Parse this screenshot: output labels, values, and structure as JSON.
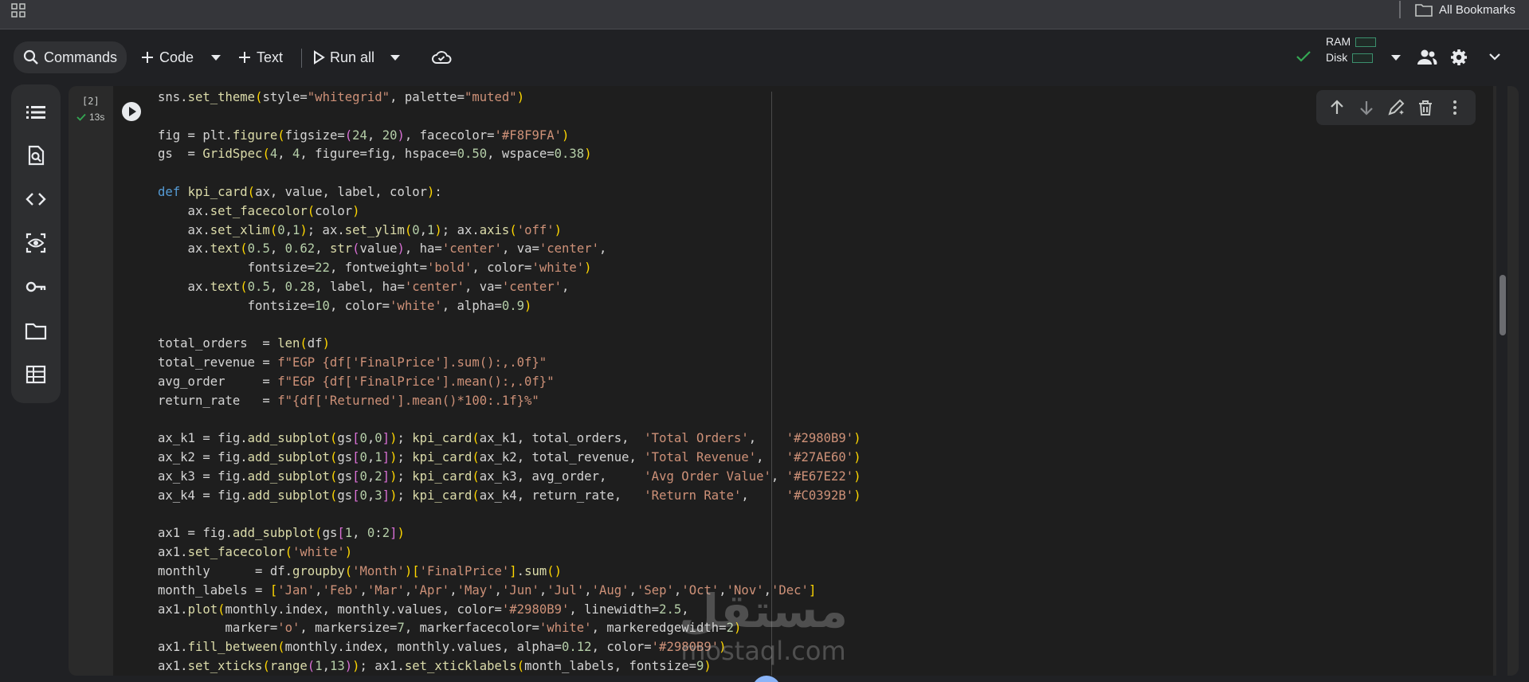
{
  "bookmarks_bar": {
    "all_bookmarks_label": "All Bookmarks",
    "apps_icon": "apps-grid-icon",
    "folder_icon": "folder-icon"
  },
  "toolbar": {
    "commands_label": "Commands",
    "code_label": "Code",
    "text_label": "Text",
    "run_all_label": "Run all",
    "ram_label": "RAM",
    "disk_label": "Disk"
  },
  "sidebar": {
    "items": [
      {
        "icon": "table-of-contents-icon"
      },
      {
        "icon": "find-replace-icon"
      },
      {
        "icon": "code-snippets-icon"
      },
      {
        "icon": "variables-icon"
      },
      {
        "icon": "secrets-key-icon"
      },
      {
        "icon": "files-folder-icon"
      },
      {
        "icon": "data-table-icon"
      }
    ]
  },
  "cell": {
    "execution_count": "[2]",
    "execution_time": "13s"
  },
  "code_lines": [
    "sns.set_theme(style=\"whitegrid\", palette=\"muted\")",
    "",
    "fig = plt.figure(figsize=(24, 20), facecolor='#F8F9FA')",
    "gs  = GridSpec(4, 4, figure=fig, hspace=0.50, wspace=0.38)",
    "",
    "def kpi_card(ax, value, label, color):",
    "    ax.set_facecolor(color)",
    "    ax.set_xlim(0,1); ax.set_ylim(0,1); ax.axis('off')",
    "    ax.text(0.5, 0.62, str(value), ha='center', va='center',",
    "            fontsize=22, fontweight='bold', color='white')",
    "    ax.text(0.5, 0.28, label, ha='center', va='center',",
    "            fontsize=10, color='white', alpha=0.9)",
    "",
    "total_orders  = len(df)",
    "total_revenue = f\"EGP {df['FinalPrice'].sum():,.0f}\"",
    "avg_order     = f\"EGP {df['FinalPrice'].mean():,.0f}\"",
    "return_rate   = f\"{df['Returned'].mean()*100:.1f}%\"",
    "",
    "ax_k1 = fig.add_subplot(gs[0,0]); kpi_card(ax_k1, total_orders,  'Total Orders',    '#2980B9')",
    "ax_k2 = fig.add_subplot(gs[0,1]); kpi_card(ax_k2, total_revenue, 'Total Revenue',   '#27AE60')",
    "ax_k3 = fig.add_subplot(gs[0,2]); kpi_card(ax_k3, avg_order,     'Avg Order Value', '#E67E22')",
    "ax_k4 = fig.add_subplot(gs[0,3]); kpi_card(ax_k4, return_rate,   'Return Rate',     '#C0392B')",
    "",
    "ax1 = fig.add_subplot(gs[1, 0:2])",
    "ax1.set_facecolor('white')",
    "monthly      = df.groupby('Month')['FinalPrice'].sum()",
    "month_labels = ['Jan','Feb','Mar','Apr','May','Jun','Jul','Aug','Sep','Oct','Nov','Dec']",
    "ax1.plot(monthly.index, monthly.values, color='#2980B9', linewidth=2.5,",
    "         marker='o', markersize=7, markerfacecolor='white', markeredgewidth=2)",
    "ax1.fill_between(monthly.index, monthly.values, alpha=0.12, color='#2980B9')",
    "ax1.set_xticks(range(1,13)); ax1.set_xticklabels(month_labels, fontsize=9)"
  ],
  "watermark": {
    "arabic": "مستقل",
    "domain": "mostaql.com"
  },
  "colors": {
    "accent_green": "#34a853",
    "page_bg": "#202124",
    "editor_bg": "#1e1e1e"
  }
}
